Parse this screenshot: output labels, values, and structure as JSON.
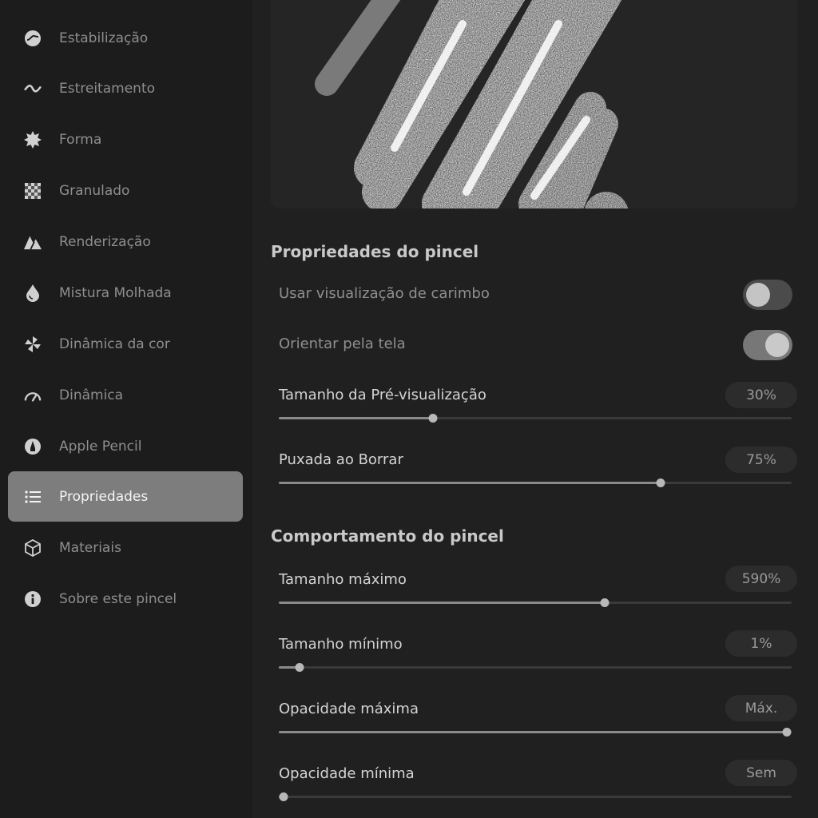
{
  "sidebar": {
    "items": [
      {
        "label": "Estabilização",
        "icon": "stabilization-icon",
        "active": false
      },
      {
        "label": "Estreitamento",
        "icon": "taper-wave-icon",
        "active": false
      },
      {
        "label": "Forma",
        "icon": "shape-burst-icon",
        "active": false
      },
      {
        "label": "Granulado",
        "icon": "grain-checker-icon",
        "active": false
      },
      {
        "label": "Renderização",
        "icon": "rendering-icon",
        "active": false
      },
      {
        "label": "Mistura Molhada",
        "icon": "water-drop-icon",
        "active": false
      },
      {
        "label": "Dinâmica da cor",
        "icon": "pinwheel-icon",
        "active": false
      },
      {
        "label": "Dinâmica",
        "icon": "speedometer-icon",
        "active": false
      },
      {
        "label": "Apple Pencil",
        "icon": "pencil-tip-icon",
        "active": false
      },
      {
        "label": "Propriedades",
        "icon": "list-icon",
        "active": true
      },
      {
        "label": "Materiais",
        "icon": "cube-icon",
        "active": false
      },
      {
        "label": "Sobre este pincel",
        "icon": "info-icon",
        "active": false
      }
    ]
  },
  "main": {
    "section_properties": {
      "title": "Propriedades do pincel",
      "stamp_preview": {
        "label": "Usar visualização de carimbo",
        "on": false
      },
      "orient_screen": {
        "label": "Orientar pela tela",
        "on": true
      },
      "preview_size": {
        "label": "Tamanho da Pré-visualização",
        "value": "30%",
        "level": 0.3
      },
      "smudge_pull": {
        "label": "Puxada ao Borrar",
        "value": "75%",
        "level": 0.745
      }
    },
    "section_behavior": {
      "title": "Comportamento do pincel",
      "max_size": {
        "label": "Tamanho máximo",
        "value": "590%",
        "level": 0.635
      },
      "min_size": {
        "label": "Tamanho mínimo",
        "value": "1%",
        "level": 0.04
      },
      "max_opacity": {
        "label": "Opacidade máxima",
        "value": "Máx.",
        "level": 0.99
      },
      "min_opacity": {
        "label": "Opacidade mínima",
        "value": "Sem",
        "level": 0.01
      }
    }
  },
  "colors": {
    "background": "#202020",
    "sidebar": "#1c1c1c",
    "active_item": "#7d7d7d",
    "stroke": "#ffffff"
  }
}
